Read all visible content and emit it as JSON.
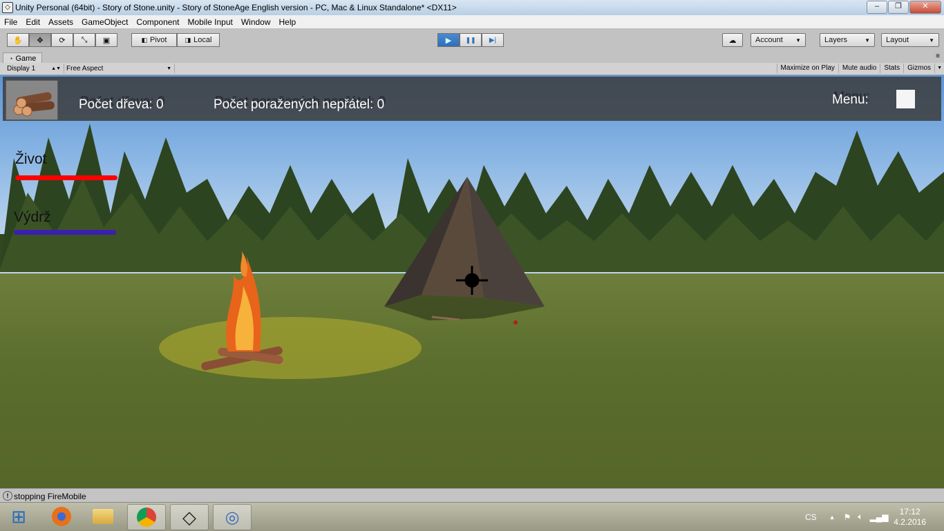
{
  "window": {
    "title": "Unity Personal (64bit) - Story of Stone.unity - Story of StoneAge English version - PC, Mac & Linux Standalone* <DX11>",
    "minimize": "–",
    "maximize": "❐",
    "close": "✕"
  },
  "menu": [
    "File",
    "Edit",
    "Assets",
    "GameObject",
    "Component",
    "Mobile Input",
    "Window",
    "Help"
  ],
  "toolbar": {
    "tools": [
      {
        "name": "hand-tool-icon",
        "glyph": "✋"
      },
      {
        "name": "move-tool-icon",
        "glyph": "✥"
      },
      {
        "name": "rotate-tool-icon",
        "glyph": "⟳"
      },
      {
        "name": "scale-tool-icon",
        "glyph": "⤡"
      },
      {
        "name": "rect-tool-icon",
        "glyph": "▣"
      }
    ],
    "pivot_label": "Pivot",
    "local_label": "Local",
    "play_glyph": "▶",
    "pause_glyph": "❚❚",
    "step_glyph": "▶|",
    "account_label": "Account",
    "layers_label": "Layers",
    "layout_label": "Layout"
  },
  "game_panel": {
    "tab_label": "Game",
    "display": "Display 1",
    "aspect": "Free Aspect",
    "options": [
      "Maximize on Play",
      "Mute audio",
      "Stats",
      "Gizmos"
    ]
  },
  "hud": {
    "wood_count_label": "Počet dřeva: 0",
    "wood_count_shadow": "Počet dřeva: 0",
    "enemies_label": "Počet poražených nepřátel: 0",
    "enemies_shadow": "Počet poražených nepřátel: 0",
    "menu_label": "Menu:",
    "health_label": "Život",
    "health_fraction": 1.0,
    "health_color": "#ff0000",
    "stamina_label": "Výdrž",
    "stamina_fraction": 1.0,
    "stamina_color": "#3a1fb0"
  },
  "status": {
    "message": "stopping FireMobile"
  },
  "taskbar": {
    "apps": [
      {
        "name": "start-button-icon",
        "glyph": "⊞"
      },
      {
        "name": "firefox-icon",
        "glyph": "🦊"
      },
      {
        "name": "file-explorer-icon",
        "glyph": "📁"
      },
      {
        "name": "chrome-icon",
        "glyph": "◉"
      },
      {
        "name": "unity-icon",
        "glyph": "◇"
      },
      {
        "name": "app-icon",
        "glyph": "◎"
      }
    ],
    "language": "CS",
    "time": "17:12",
    "date": "4.2.2016"
  }
}
